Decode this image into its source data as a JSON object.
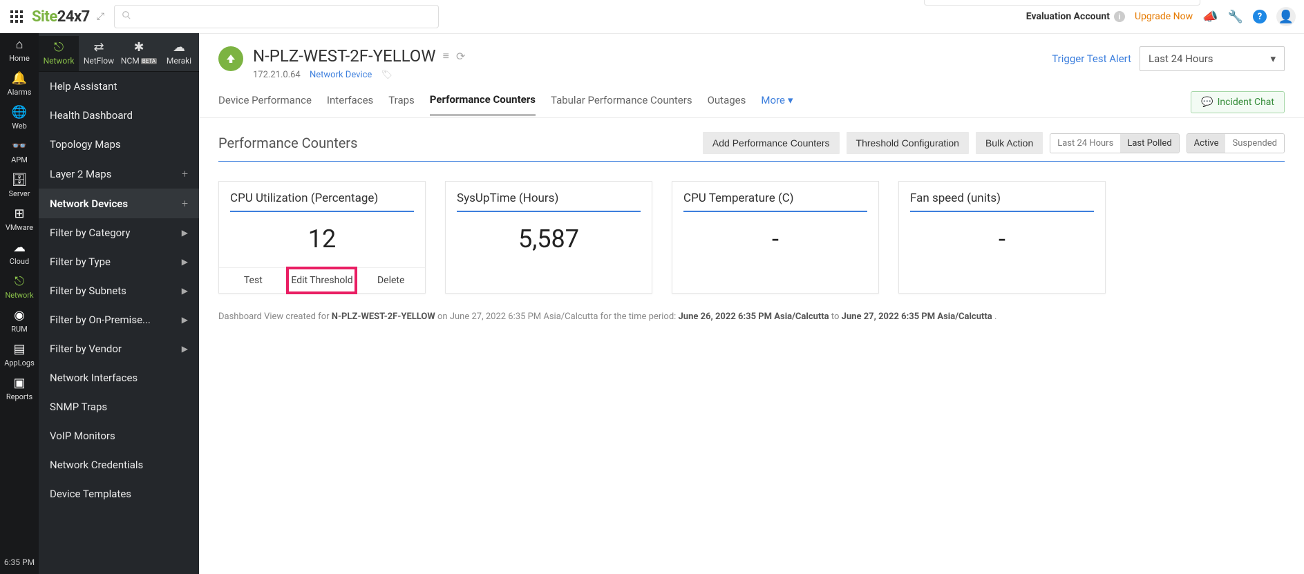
{
  "brand": {
    "part1": "Site",
    "part2": "24x7"
  },
  "topbar": {
    "evaluation_label": "Evaluation Account",
    "upgrade_label": "Upgrade Now"
  },
  "rail": {
    "items": [
      {
        "label": "Home",
        "icon": "⌂"
      },
      {
        "label": "Alarms",
        "icon": "🔔"
      },
      {
        "label": "Web",
        "icon": "🌐"
      },
      {
        "label": "APM",
        "icon": "👓"
      },
      {
        "label": "Server",
        "icon": "🗄"
      },
      {
        "label": "VMware",
        "icon": "⊞"
      },
      {
        "label": "Cloud",
        "icon": "☁"
      },
      {
        "label": "Network",
        "icon": "⎋"
      },
      {
        "label": "RUM",
        "icon": "◉"
      },
      {
        "label": "AppLogs",
        "icon": "▤"
      },
      {
        "label": "Reports",
        "icon": "▣"
      }
    ],
    "time": "6:35 PM"
  },
  "sidebar_tabs": [
    {
      "label": "Network",
      "icon": "⎋"
    },
    {
      "label": "NetFlow",
      "icon": "⇄"
    },
    {
      "label": "NCM",
      "icon": "✱",
      "beta": "BETA"
    },
    {
      "label": "Meraki",
      "icon": "☁"
    }
  ],
  "sidebar_items": [
    {
      "label": "Help Assistant"
    },
    {
      "label": "Health Dashboard"
    },
    {
      "label": "Topology Maps"
    },
    {
      "label": "Layer 2 Maps",
      "plus": true
    },
    {
      "label": "Network Devices",
      "plus": true,
      "selected": true
    },
    {
      "label": "Filter by Category",
      "chev": true
    },
    {
      "label": "Filter by Type",
      "chev": true
    },
    {
      "label": "Filter by Subnets",
      "chev": true
    },
    {
      "label": "Filter by On-Premise...",
      "chev": true
    },
    {
      "label": "Filter by Vendor",
      "chev": true
    },
    {
      "label": "Network Interfaces"
    },
    {
      "label": "SNMP Traps"
    },
    {
      "label": "VoIP Monitors"
    },
    {
      "label": "Network Credentials"
    },
    {
      "label": "Device Templates"
    }
  ],
  "device": {
    "name": "N-PLZ-WEST-2F-YELLOW",
    "ip": "172.21.0.64",
    "type_link": "Network Device"
  },
  "header_actions": {
    "trigger": "Trigger Test Alert",
    "time_range": "Last 24 Hours"
  },
  "tabs": [
    "Device Performance",
    "Interfaces",
    "Traps",
    "Performance Counters",
    "Tabular Performance Counters",
    "Outages"
  ],
  "more_label": "More",
  "incident_chat": "Incident Chat",
  "section": {
    "title": "Performance Counters",
    "buttons": {
      "add": "Add Performance Counters",
      "threshold": "Threshold Configuration",
      "bulk": "Bulk Action"
    },
    "toggle1": {
      "a": "Last 24 Hours",
      "b": "Last Polled"
    },
    "toggle2": {
      "a": "Active",
      "b": "Suspended"
    }
  },
  "cards": [
    {
      "title": "CPU Utilization (Percentage)",
      "value": "12",
      "actions": [
        "Test",
        "Edit Threshold",
        "Delete"
      ],
      "highlight_idx": 1
    },
    {
      "title": "SysUpTime (Hours)",
      "value": "5,587"
    },
    {
      "title": "CPU Temperature (C)",
      "value": "-"
    },
    {
      "title": "Fan speed (units)",
      "value": "-"
    }
  ],
  "footer": {
    "prefix": "Dashboard View created for ",
    "device": "N-PLZ-WEST-2F-YELLOW",
    "mid": " on June 27, 2022 6:35 PM Asia/Calcutta for the time period: ",
    "from": "June 26, 2022 6:35 PM Asia/Calcutta",
    "to_word": " to ",
    "to": "June 27, 2022 6:35 PM Asia/Calcutta",
    "suffix": " ."
  }
}
